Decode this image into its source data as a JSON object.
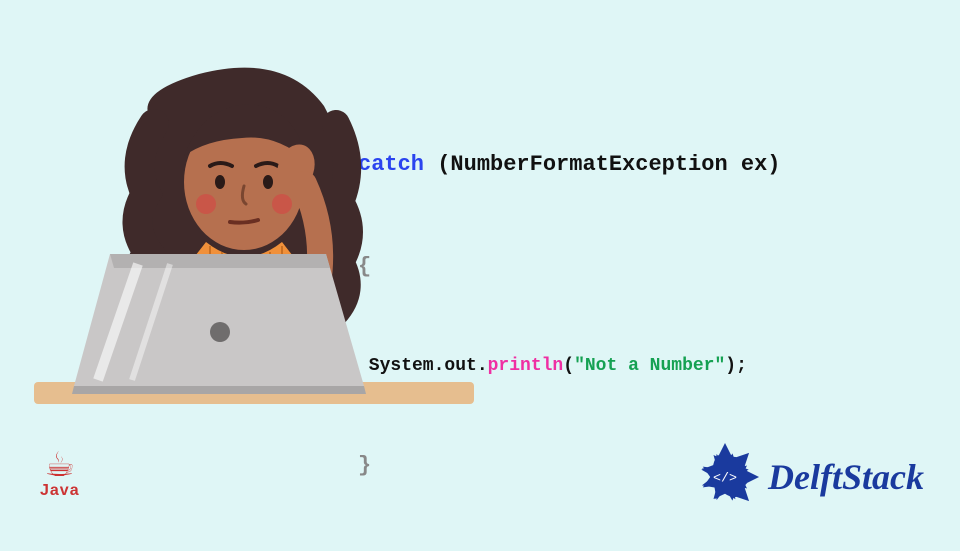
{
  "code": {
    "kw": "catch",
    "sig": " (NumberFormatException ex)",
    "open": "{",
    "stmt_a": " System.out.",
    "call": "println",
    "stmt_b": "(",
    "str": "\"Not a Number\"",
    "stmt_c": ");",
    "close": "}"
  },
  "java_label": "Java",
  "brand": "DelftStack"
}
